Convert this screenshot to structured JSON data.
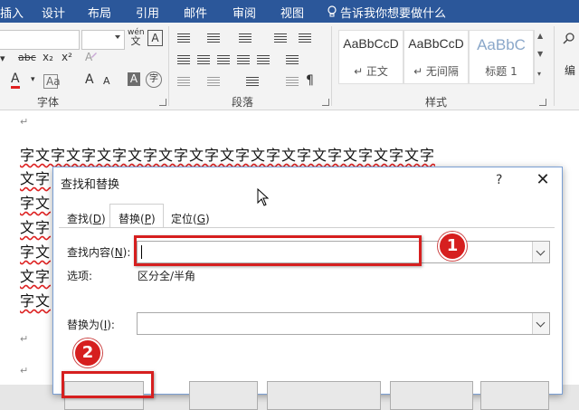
{
  "ribbon_tabs": [
    "插入",
    "设计",
    "布局",
    "引用",
    "邮件",
    "审阅",
    "视图"
  ],
  "tell_me": "告诉我你想要做什么",
  "font_group": {
    "label": "字体",
    "wen_label": "wén",
    "wen_char": "文",
    "a_box": "A",
    "strike": "abc",
    "subscript": "x₂",
    "superscript": "x²",
    "font_color_a": "A",
    "aa_big": "A",
    "aa_small": "A",
    "shade_a": "A",
    "circle_char": "字"
  },
  "paragraph_group": {
    "label": "段落"
  },
  "styles_group": {
    "label": "样式",
    "styles": [
      {
        "preview": "AaBbCcD",
        "name": "↵ 正文"
      },
      {
        "preview": "AaBbCcD",
        "name": "↵ 无间隔"
      },
      {
        "preview": "AaBbC",
        "name": "标题 1"
      }
    ]
  },
  "editing_group": {
    "label": "编"
  },
  "document": {
    "lines": [
      "字文字文字文字文字文字文字文字文字文字文字文字文字文字",
      "文字",
      "字文",
      "文字",
      "字文",
      "文字",
      "字文"
    ],
    "para_mark": "↵"
  },
  "dialog": {
    "title": "查找和替换",
    "help": "?",
    "close": "✕",
    "tabs": [
      {
        "text": "查找(",
        "key": "D",
        "end": ")"
      },
      {
        "text": "替换(",
        "key": "P",
        "end": ")"
      },
      {
        "text": "定位(",
        "key": "G",
        "end": ")"
      }
    ],
    "find_label": {
      "text": "查找内容(",
      "key": "N",
      "end": "):"
    },
    "find_value": "",
    "options_label": "选项:",
    "options_value": "区分全/半角",
    "replace_label": {
      "text": "替换为(",
      "key": "I",
      "end": "):"
    },
    "replace_value": ""
  },
  "annotations": {
    "badge1": "1",
    "badge2": "2"
  },
  "colors": {
    "ribbon_blue": "#2b579a",
    "annotation_red": "#d61f1f",
    "font_color_red": "#e02020"
  }
}
